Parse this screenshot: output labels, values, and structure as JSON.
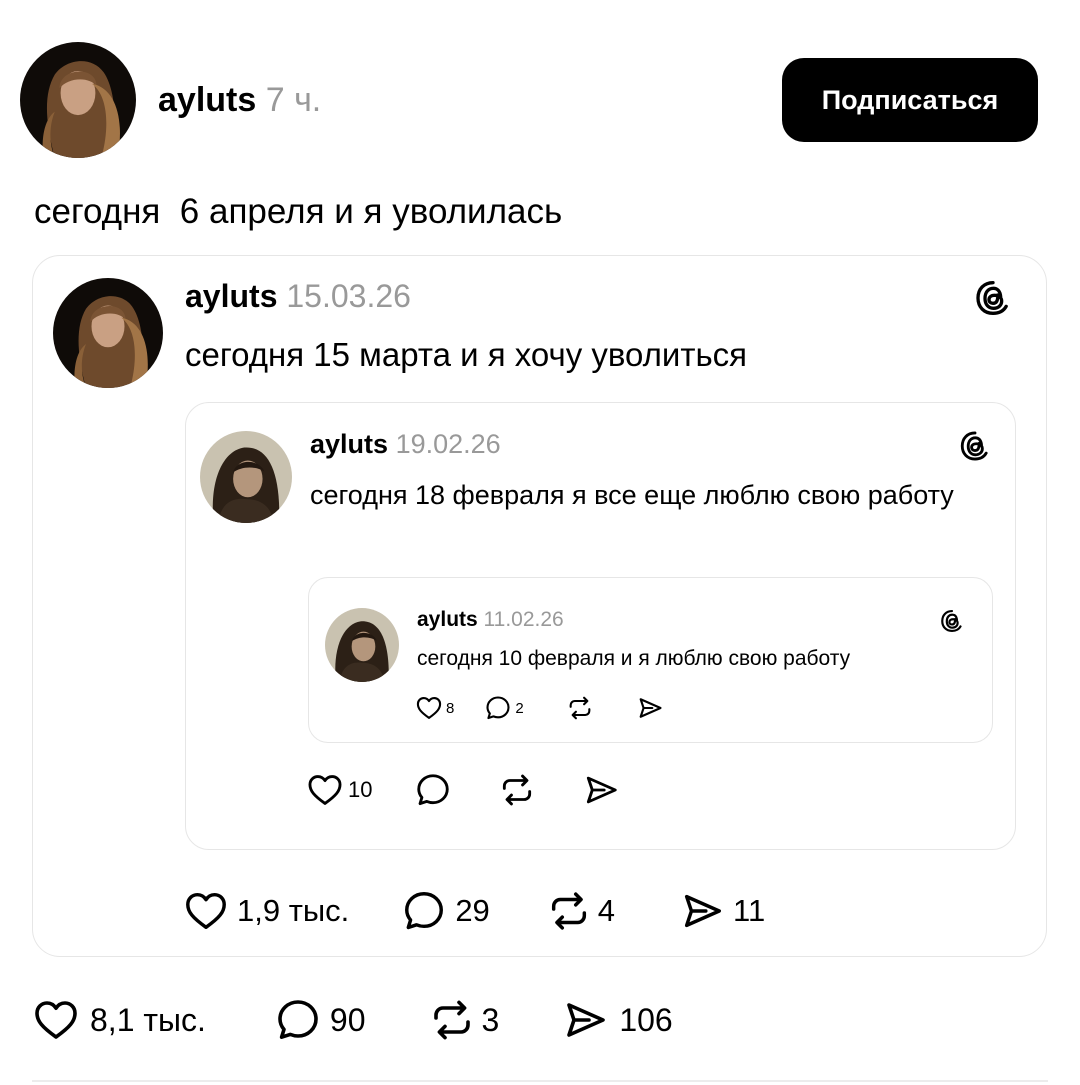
{
  "post": {
    "username": "ayluts",
    "time": "7 ч.",
    "follow_label": "Подписаться",
    "text": "сегодня  6 апреля и я уволилась",
    "likes": "8,1 тыс.",
    "comments": "90",
    "reposts": "3",
    "shares": "106"
  },
  "quote1": {
    "username": "ayluts",
    "date": "15.03.26",
    "text": "сегодня 15 марта и я хочу уволиться",
    "likes": "1,9 тыс.",
    "comments": "29",
    "reposts": "4",
    "shares": "11"
  },
  "quote2": {
    "username": "ayluts",
    "date": "19.02.26",
    "text": "сегодня 18 февраля я все еще люблю свою работу",
    "likes": "10"
  },
  "quote3": {
    "username": "ayluts",
    "date": "11.02.26",
    "text": "сегодня 10 февраля и я люблю свою работу",
    "likes": "8",
    "comments": "2"
  },
  "icons": {
    "like": "heart-icon",
    "comment": "comment-bubble-icon",
    "repost": "repost-icon",
    "share": "send-icon",
    "threads": "threads-logo-icon"
  }
}
